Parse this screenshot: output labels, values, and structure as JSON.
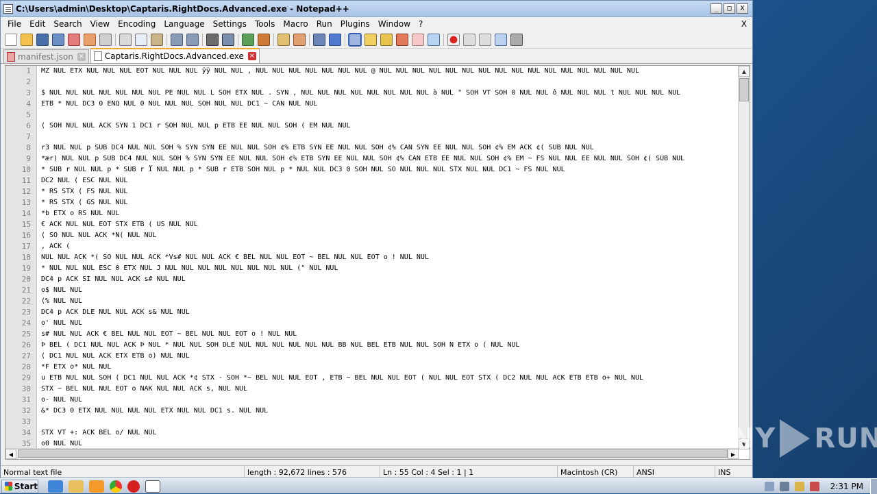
{
  "window": {
    "title": "C:\\Users\\admin\\Desktop\\Captaris.RightDocs.Advanced.exe - Notepad++",
    "min": "_",
    "max": "□",
    "close": "X"
  },
  "menu": {
    "items": [
      "File",
      "Edit",
      "Search",
      "View",
      "Encoding",
      "Language",
      "Settings",
      "Tools",
      "Macro",
      "Run",
      "Plugins",
      "Window",
      "?"
    ],
    "close": "X"
  },
  "toolbar": {
    "icons": [
      "new-file-icon",
      "open-file-icon",
      "save-icon",
      "save-all-icon",
      "close-icon",
      "close-all-icon",
      "print-icon",
      "cut-icon",
      "copy-icon",
      "paste-icon",
      "undo-icon",
      "redo-icon",
      "find-icon",
      "replace-icon",
      "zoom-in-icon",
      "zoom-out-icon",
      "sync-v-icon",
      "sync-h-icon",
      "wrap-icon",
      "all-chars-icon",
      "indent-guide-icon",
      "lang-icon",
      "doc-map-icon",
      "func-list-icon",
      "folder-icon",
      "monitor-icon",
      "record-icon",
      "stop-icon",
      "play-icon",
      "play-multi-icon",
      "save-macro-icon"
    ]
  },
  "tabs": [
    {
      "label": "manifest.json",
      "active": false
    },
    {
      "label": "Captaris.RightDocs.Advanced.exe",
      "active": true
    }
  ],
  "editor": {
    "lines": [
      {
        "n": "1",
        "t": "MZ NUL ETX NUL NUL NUL EOT NUL NUL NUL ÿÿ NUL NUL , NUL NUL NUL NUL NUL NUL NUL @ NUL NUL NUL NUL NUL NUL NUL NUL NUL NUL NUL NUL NUL NUL NUL NUL"
      },
      {
        "n": "2",
        "t": ""
      },
      {
        "n": "3",
        "t": "$ NUL NUL NUL NUL NUL NUL NUL PE NUL NUL L SOH ETX NUL . SYN , NUL NUL NUL NUL NUL NUL NUL NUL à NUL \" SOH VT SOH 0 NUL NUL ô NUL NUL NUL t NUL NUL NUL NUL"
      },
      {
        "n": "4",
        "t": "ETB * NUL DC3 0 ENQ NUL 0 NUL NUL NUL SOH NUL NUL DC1 ~ CAN NUL NUL"
      },
      {
        "n": "5",
        "t": ""
      },
      {
        "n": "6",
        "t": "( SOH NUL NUL ACK SYN 1 DC1 r SOH NUL NUL p ETB EE NUL NUL SOH ( EM NUL NUL"
      },
      {
        "n": "7",
        "t": ""
      },
      {
        "n": "8",
        "t": "r3 NUL NUL p SUB DC4 NUL NUL SOH % SYN SYN EE NUL NUL SOH ¢% ETB SYN EE NUL NUL SOH ¢% CAN SYN EE NUL NUL SOH ¢% EM ACK ¢( SUB NUL NUL"
      },
      {
        "n": "9",
        "t": "*ær) NUL NUL p SUB DC4 NUL NUL SOH % SYN SYN EE NUL NUL SOH ¢% ETB SYN EE NUL NUL SOH ¢% CAN ETB EE NUL NUL SOH ¢% EM ~ FS NUL NUL EE NUL NUL SOH ¢( SUB NUL"
      },
      {
        "n": "10",
        "t": "* SUB r NUL NUL p * SUB r Ï NUL NUL p * SUB r ETB SOH NUL p * NUL NUL DC3 0 SOH NUL SO NUL NUL NUL STX NUL NUL DC1 ~ FS NUL NUL"
      },
      {
        "n": "11",
        "t": "DC2 NUL ( ESC NUL NUL"
      },
      {
        "n": "12",
        "t": "* RS STX ( FS NUL NUL"
      },
      {
        "n": "13",
        "t": "* RS STX ( GS NUL NUL"
      },
      {
        "n": "14",
        "t": "*b ETX o RS NUL NUL"
      },
      {
        "n": "15",
        "t": "€ ACK NUL NUL EOT STX ETB ( US NUL NUL"
      },
      {
        "n": "16",
        "t": "( SO NUL NUL ACK *N( NUL NUL"
      },
      {
        "n": "17",
        "t": ", ACK ("
      },
      {
        "n": "18",
        "t": "NUL NUL ACK *( SO NUL NUL ACK *Vs# NUL NUL ACK € BEL NUL NUL EOT ~ BEL NUL NUL EOT o ! NUL NUL"
      },
      {
        "n": "19",
        "t": "* NUL NUL NUL ESC 0 ETX NUL J NUL NUL NUL NUL NUL NUL NUL NUL (\" NUL NUL"
      },
      {
        "n": "20",
        "t": "DC4 p ACK SI NUL NUL ACK s# NUL NUL"
      },
      {
        "n": "21",
        "t": "o$ NUL NUL"
      },
      {
        "n": "22",
        "t": "(% NUL NUL"
      },
      {
        "n": "23",
        "t": "DC4 p ACK DLE NUL NUL ACK s& NUL NUL"
      },
      {
        "n": "24",
        "t": "o' NUL NUL"
      },
      {
        "n": "25",
        "t": "s# NUL NUL ACK € BEL NUL NUL EOT ~ BEL NUL NUL EOT o ! NUL NUL"
      },
      {
        "n": "26",
        "t": "Þ BEL ( DC1 NUL NUL ACK Þ NUL * NUL NUL SOH DLE NUL NUL NUL NUL NUL NUL BB NUL BEL ETB NUL NUL SOH N ETX o ( NUL NUL"
      },
      {
        "n": "27",
        "t": "( DC1 NUL NUL ACK ETX ETB o) NUL NUL"
      },
      {
        "n": "28",
        "t": "*F ETX o* NUL NUL"
      },
      {
        "n": "29",
        "t": "u ETB NUL NUL SOH ( DC1 NUL NUL ACK *¢ STX - SOH *~ BEL NUL NUL EOT , ETB ~ BEL NUL NUL EOT ( NUL NUL EOT STX ( DC2 NUL NUL ACK ETB ETB o+ NUL NUL"
      },
      {
        "n": "30",
        "t": "STX ~ BEL NUL NUL EOT o NAK NUL NUL ACK s, NUL NUL"
      },
      {
        "n": "31",
        "t": "o- NUL NUL"
      },
      {
        "n": "32",
        "t": "&* DC3 0 ETX NUL NUL NUL NUL ETX NUL NUL DC1 s. NUL NUL"
      },
      {
        "n": "33",
        "t": ""
      },
      {
        "n": "34",
        "t": "STX VT +: ACK BEL o/ NUL NUL"
      },
      {
        "n": "35",
        "t": "o0 NUL NUL"
      }
    ]
  },
  "status": {
    "type": "Normal text file",
    "length": "length : 92,672    lines : 576",
    "pos": "Ln : 55    Col : 4    Sel : 1 | 1",
    "eol": "Macintosh (CR)",
    "enc": "ANSI",
    "ins": "INS"
  },
  "taskbar": {
    "start": "Start",
    "clock": "2:31 PM"
  },
  "watermark": {
    "left": "ANY",
    "right": "RUN"
  }
}
